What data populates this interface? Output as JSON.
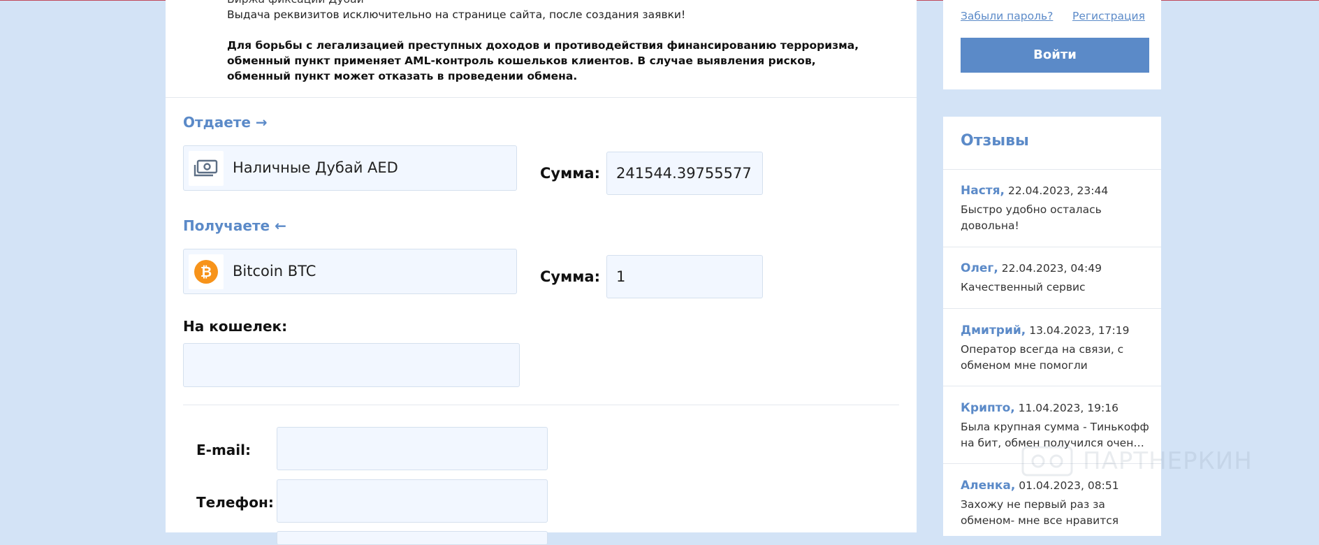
{
  "notice": {
    "cut_line": "Биржа фиксации Дубай",
    "line1": "Выдача реквизитов исключительно на странице сайта, после создания заявки!",
    "aml": "Для борьбы с легализацией преступных доходов и противодействия финансированию терроризма, обменный пункт применяет AML-контроль кошельков клиентов. В случае выявления рисков, обменный пункт может отказать в проведении обмена."
  },
  "give": {
    "title": "Отдаете →",
    "currency": "Наличные Дубай AED",
    "icon": "cash-icon",
    "amount_label": "Сумма:",
    "amount_value": "241544.39755577"
  },
  "get": {
    "title": "Получаете ←",
    "currency": "Bitcoin BTC",
    "icon": "bitcoin-icon",
    "amount_label": "Сумма:",
    "amount_value": "1"
  },
  "wallet": {
    "label": "На кошелек:",
    "value": ""
  },
  "contacts": {
    "email_label": "E-mail:",
    "email_value": "",
    "phone_label": "Телефон:",
    "phone_value": ""
  },
  "login": {
    "forgot": "Забыли пароль?",
    "register": "Регистрация",
    "submit": "Войти"
  },
  "reviews": {
    "title": "Отзывы",
    "items": [
      {
        "name": "Настя,",
        "date": "22.04.2023, 23:44",
        "text": "Быстро удобно осталась довольна!"
      },
      {
        "name": "Олег,",
        "date": "22.04.2023, 04:49",
        "text": "Качественный сервис"
      },
      {
        "name": "Дмитрий,",
        "date": "13.04.2023, 17:19",
        "text": "Оператор всегда на связи, с обменом мне помогли"
      },
      {
        "name": "Крипто,",
        "date": "11.04.2023, 19:16",
        "text_line1": "Была крупная сумма - Тинькофф",
        "text_line2": "на бит, обмен получился очень..."
      },
      {
        "name": "Аленка,",
        "date": "01.04.2023, 08:51",
        "text": "Захожу не первый раз за обменом- мне все нравится"
      }
    ]
  },
  "watermark": "ПАРТНЕРКИН",
  "colors": {
    "accent": "#5b8ac8",
    "page_bg": "#d3e3f6",
    "field_bg": "#f2f7ff",
    "bitcoin": "#f7931a"
  }
}
